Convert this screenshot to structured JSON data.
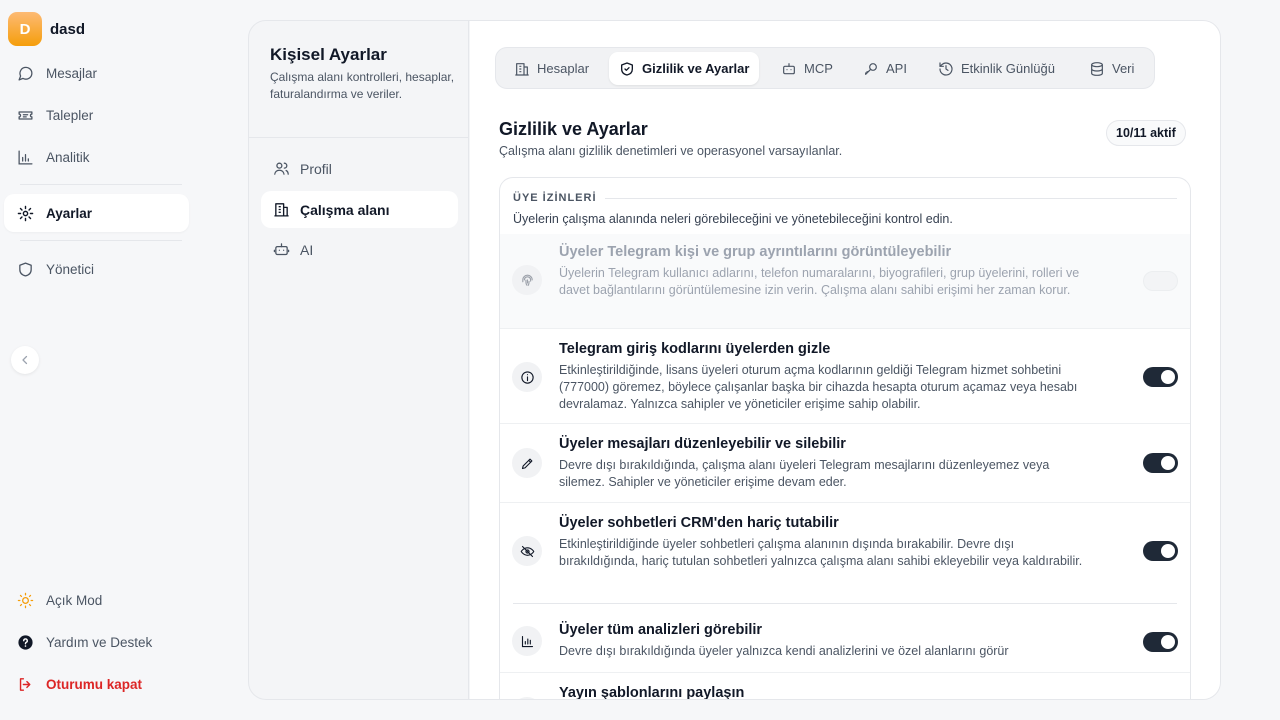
{
  "brand": {
    "initial": "D",
    "name": "dasd"
  },
  "nav": {
    "messages": "Mesajlar",
    "requests": "Talepler",
    "analytics": "Analitik",
    "settings": "Ayarlar",
    "admin": "Yönetici",
    "light_mode": "Açık Mod",
    "help": "Yardım ve Destek",
    "logout": "Oturumu kapat"
  },
  "settings_side": {
    "title": "Kişisel Ayarlar",
    "description": "Çalışma alanı kontrolleri, hesaplar, faturalandırma ve veriler.",
    "items": [
      "Profil",
      "Çalışma alanı",
      "AI"
    ]
  },
  "tabs": [
    "Hesaplar",
    "Gizlilik ve Ayarlar",
    "MCP",
    "API",
    "Etkinlik Günlüğü",
    "Veri"
  ],
  "page": {
    "title": "Gizlilik ve Ayarlar",
    "subtitle": "Çalışma alanı gizlilik denetimleri ve operasyonel varsayılanlar.",
    "active_count": "10/11 aktif"
  },
  "section": {
    "label": "ÜYE İZİNLERİ",
    "description": "Üyelerin çalışma alanında neleri görebileceğini ve yönetebileceğini kontrol edin."
  },
  "rows": [
    {
      "title": "Üyeler Telegram kişi ve grup ayrıntılarını görüntüleyebilir",
      "description": "Üyelerin Telegram kullanıcı adlarını, telefon numaralarını, biyografileri, grup üyelerini, rolleri ve davet bağlantılarını görüntülemesine izin verin. Çalışma alanı sahibi erişimi her zaman korur.",
      "icon": "fingerprint-icon",
      "enabled": false,
      "disabled": true
    },
    {
      "title": "Telegram giriş kodlarını üyelerden gizle",
      "description": "Etkinleştirildiğinde, lisans üyeleri oturum açma kodlarının geldiği Telegram hizmet sohbetini (777000) göremez, böylece çalışanlar başka bir cihazda hesapta oturum açamaz veya hesabı devralamaz. Yalnızca sahipler ve yöneticiler erişime sahip olabilir.",
      "icon": "info-icon",
      "enabled": true
    },
    {
      "title": "Üyeler mesajları düzenleyebilir ve silebilir",
      "description": "Devre dışı bırakıldığında, çalışma alanı üyeleri Telegram mesajlarını düzenleyemez veya silemez. Sahipler ve yöneticiler erişime devam eder.",
      "icon": "pencil-icon",
      "enabled": true
    },
    {
      "title": "Üyeler sohbetleri CRM'den hariç tutabilir",
      "description": "Etkinleştirildiğinde üyeler sohbetleri çalışma alanının dışında bırakabilir. Devre dışı bırakıldığında, hariç tutulan sohbetleri yalnızca çalışma alanı sahibi ekleyebilir veya kaldırabilir.",
      "icon": "eye-off-icon",
      "enabled": true
    },
    {
      "title": "Üyeler tüm analizleri görebilir",
      "description": "Devre dışı bırakıldığında üyeler yalnızca kendi analizlerini ve özel alanlarını görür",
      "icon": "chart-icon",
      "enabled": true
    },
    {
      "title": "Yayın şablonlarını paylaşın",
      "description": "",
      "icon": "share-icon",
      "enabled": true
    }
  ]
}
